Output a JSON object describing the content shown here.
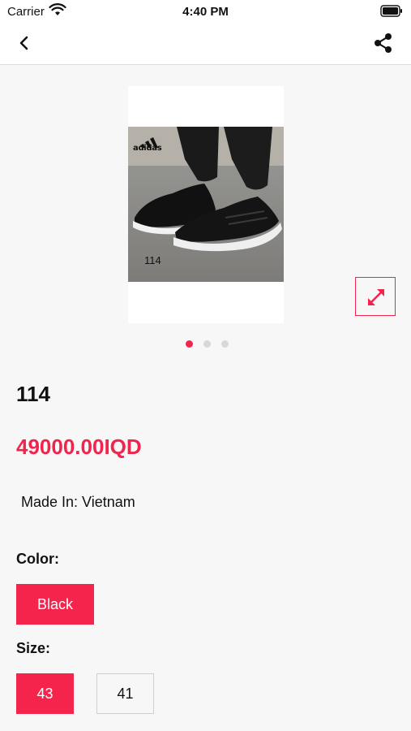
{
  "status_bar": {
    "carrier": "Carrier",
    "time": "4:40 PM",
    "icons": [
      "wifi-icon",
      "battery-icon"
    ]
  },
  "nav_bar": {
    "icons": [
      "back-chevron-icon",
      "share-icon"
    ]
  },
  "gallery": {
    "image_label": "114",
    "brand_text": "adidas",
    "page_count": 3,
    "active_page": 1,
    "expand_icon": "expand-arrows-icon"
  },
  "product": {
    "title": "114",
    "price": "49000.00IQD",
    "made_in_label": "Made In:",
    "made_in_value": "Vietnam"
  },
  "color": {
    "label": "Color:",
    "options": [
      "Black"
    ],
    "selected": "Black"
  },
  "size": {
    "label": "Size:",
    "options": [
      "43",
      "41"
    ],
    "selected": "43"
  },
  "colors": {
    "accent": "#f5244d",
    "background": "#f7f7f7",
    "inactive_dot": "#d8d8d8"
  }
}
